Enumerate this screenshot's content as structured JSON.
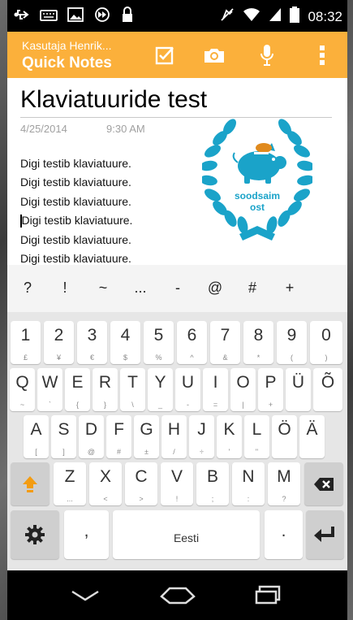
{
  "status_bar": {
    "time": "08:32",
    "left_icons": [
      "usb-icon",
      "keyboard-icon",
      "image-icon",
      "fast-forward-icon",
      "lock-icon"
    ],
    "right_icons": [
      "mute-icon",
      "wifi-icon",
      "signal-icon",
      "battery-icon"
    ]
  },
  "header": {
    "user": "Kasutaja Henrik...",
    "title": "Quick Notes",
    "actions": [
      "checkbox-icon",
      "camera-icon",
      "microphone-icon",
      "overflow-menu-icon"
    ],
    "color": "#fbb03b"
  },
  "note": {
    "title": "Klaviatuuride test",
    "date": "4/25/2014",
    "time": "9:30 AM",
    "lines": [
      "Digi testib klaviatuure.",
      "Digi testib klaviatuure.",
      "Digi testib klaviatuure.",
      "Digi testib klaviatuure.",
      "Digi testib klaviatuure.",
      "Digi testib klaviatuure."
    ],
    "badge": {
      "line1": "soodsaim",
      "line2": "ost",
      "color": "#1aa3c9"
    }
  },
  "suggestions": [
    "?",
    "!",
    "~",
    "...",
    "-",
    "@",
    "#",
    "+"
  ],
  "keyboard": {
    "row1": [
      {
        "main": "1",
        "sub": "£"
      },
      {
        "main": "2",
        "sub": "¥"
      },
      {
        "main": "3",
        "sub": "€"
      },
      {
        "main": "4",
        "sub": "$"
      },
      {
        "main": "5",
        "sub": "%"
      },
      {
        "main": "6",
        "sub": "^"
      },
      {
        "main": "7",
        "sub": "&"
      },
      {
        "main": "8",
        "sub": "*"
      },
      {
        "main": "9",
        "sub": "("
      },
      {
        "main": "0",
        "sub": ")"
      }
    ],
    "row2": [
      {
        "main": "Q",
        "sub": "~"
      },
      {
        "main": "W",
        "sub": "`"
      },
      {
        "main": "E",
        "sub": "{"
      },
      {
        "main": "R",
        "sub": "}"
      },
      {
        "main": "T",
        "sub": "\\"
      },
      {
        "main": "Y",
        "sub": "_"
      },
      {
        "main": "U",
        "sub": "-"
      },
      {
        "main": "I",
        "sub": "="
      },
      {
        "main": "O",
        "sub": "|"
      },
      {
        "main": "P",
        "sub": "+"
      },
      {
        "main": "Ü",
        "sub": ""
      },
      {
        "main": "Õ",
        "sub": ""
      }
    ],
    "row3": [
      {
        "main": "A",
        "sub": "["
      },
      {
        "main": "S",
        "sub": "]"
      },
      {
        "main": "D",
        "sub": "@"
      },
      {
        "main": "F",
        "sub": "#"
      },
      {
        "main": "G",
        "sub": "±"
      },
      {
        "main": "H",
        "sub": "/"
      },
      {
        "main": "J",
        "sub": "÷"
      },
      {
        "main": "K",
        "sub": "'"
      },
      {
        "main": "L",
        "sub": "\""
      },
      {
        "main": "Ö",
        "sub": ""
      },
      {
        "main": "Ä",
        "sub": ""
      }
    ],
    "row4": [
      {
        "main": "Z",
        "sub": "..."
      },
      {
        "main": "X",
        "sub": "<"
      },
      {
        "main": "C",
        "sub": ">"
      },
      {
        "main": "V",
        "sub": "!"
      },
      {
        "main": "B",
        "sub": ";"
      },
      {
        "main": "N",
        "sub": ":"
      },
      {
        "main": "M",
        "sub": "?"
      }
    ],
    "comma": ",",
    "period": ".",
    "space_label": "Eesti",
    "shift_color": "#f39c12"
  },
  "nav_bar": {
    "icons": [
      "back-icon",
      "home-icon",
      "recents-icon"
    ]
  }
}
